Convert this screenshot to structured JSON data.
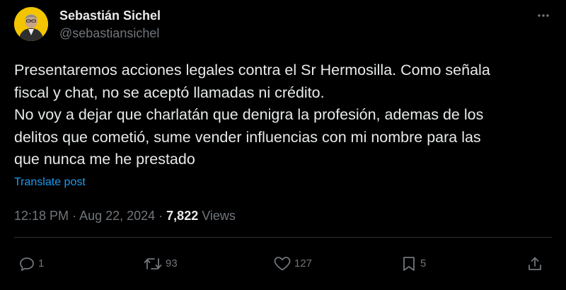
{
  "author": {
    "display_name": "Sebastián Sichel",
    "handle": "@sebastiansichel"
  },
  "tweet": {
    "lines": [
      "Presentaremos acciones legales contra el Sr Hermosilla. Como señala",
      "fiscal y chat, no se aceptó llamadas ni crédito.",
      "No voy a dejar que charlatán que denigra la profesión, ademas de los",
      "delitos que cometió, sume vender influencias con mi nombre para las",
      "que nunca me he prestado"
    ],
    "translate_label": "Translate post"
  },
  "meta": {
    "time": "12:18 PM",
    "separator": " · ",
    "date": "Aug 22, 2024",
    "views_count": "7,822",
    "views_label": " Views"
  },
  "actions": {
    "replies": "1",
    "reposts": "93",
    "likes": "127",
    "bookmarks": "5"
  },
  "icons": {
    "more": "more-horizontal-icon",
    "reply": "reply-icon",
    "repost": "repost-icon",
    "like": "heart-icon",
    "bookmark": "bookmark-icon",
    "share": "share-icon"
  },
  "colors": {
    "background": "#000000",
    "text": "#e7e9ea",
    "secondary_text": "#71767b",
    "link": "#1d9bf0",
    "avatar_bg": "#f2c500",
    "divider": "#2f3336"
  }
}
